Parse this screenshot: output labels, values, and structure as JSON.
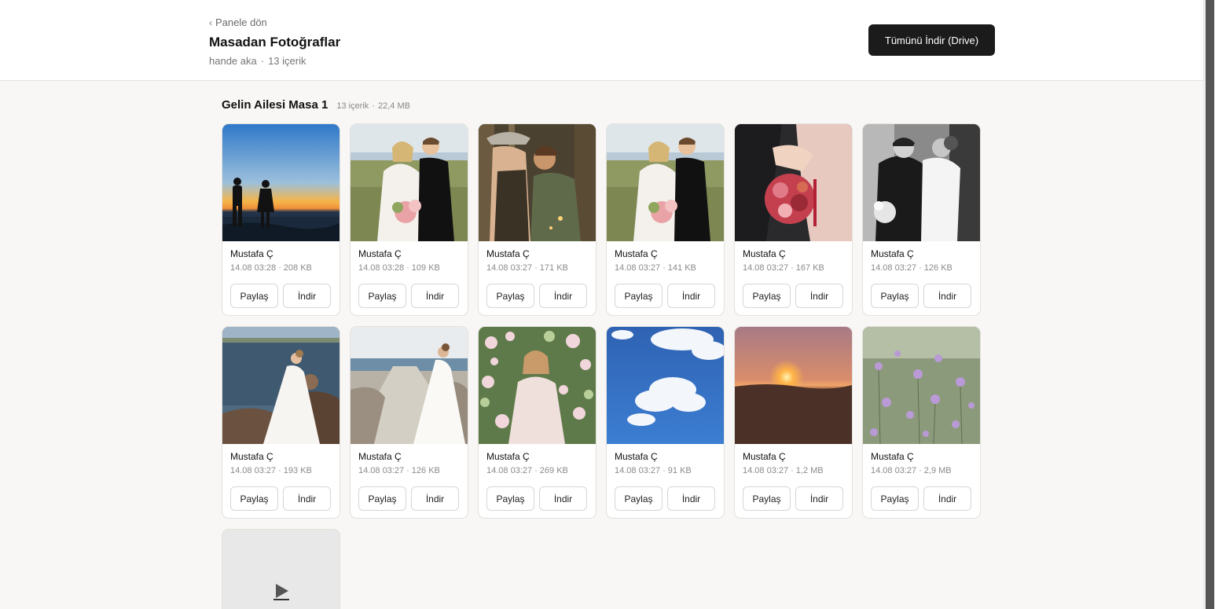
{
  "header": {
    "back_label": "Panele dön",
    "title": "Masadan Fotoğraflar",
    "owner": "hande aka",
    "count": "13 içerik",
    "download_all": "Tümünü İndir (Drive)"
  },
  "group": {
    "title": "Gelin Ailesi Masa 1",
    "count": "13 içerik",
    "size": "22,4 MB"
  },
  "labels": {
    "share": "Paylaş",
    "download": "İndir"
  },
  "items": [
    {
      "author": "Mustafa Ç",
      "time": "14.08 03:28",
      "size": "208 KB",
      "scene": "sunset-beach-couple"
    },
    {
      "author": "Mustafa Ç",
      "time": "14.08 03:28",
      "size": "109 KB",
      "scene": "bride-groom-field"
    },
    {
      "author": "Mustafa Ç",
      "time": "14.08 03:27",
      "size": "171 KB",
      "scene": "couple-kiss-forest"
    },
    {
      "author": "Mustafa Ç",
      "time": "14.08 03:27",
      "size": "141 KB",
      "scene": "bride-groom-field"
    },
    {
      "author": "Mustafa Ç",
      "time": "14.08 03:27",
      "size": "167 KB",
      "scene": "bouquet-closeup"
    },
    {
      "author": "Mustafa Ç",
      "time": "14.08 03:27",
      "size": "126 KB",
      "scene": "bw-couple"
    },
    {
      "author": "Mustafa Ç",
      "time": "14.08 03:27",
      "size": "193 KB",
      "scene": "bride-rocks-sea"
    },
    {
      "author": "Mustafa Ç",
      "time": "14.08 03:27",
      "size": "126 KB",
      "scene": "bride-pier"
    },
    {
      "author": "Mustafa Ç",
      "time": "14.08 03:27",
      "size": "269 KB",
      "scene": "woman-flowers"
    },
    {
      "author": "Mustafa Ç",
      "time": "14.08 03:27",
      "size": "91 KB",
      "scene": "blue-sky-clouds"
    },
    {
      "author": "Mustafa Ç",
      "time": "14.08 03:27",
      "size": "1,2 MB",
      "scene": "sun-horizon"
    },
    {
      "author": "Mustafa Ç",
      "time": "14.08 03:27",
      "size": "2,9 MB",
      "scene": "lavender-flowers"
    }
  ],
  "colors": {
    "primary_button": "#1b1b1b",
    "background": "#f8f7f5",
    "card_border": "#e3e1dd"
  }
}
